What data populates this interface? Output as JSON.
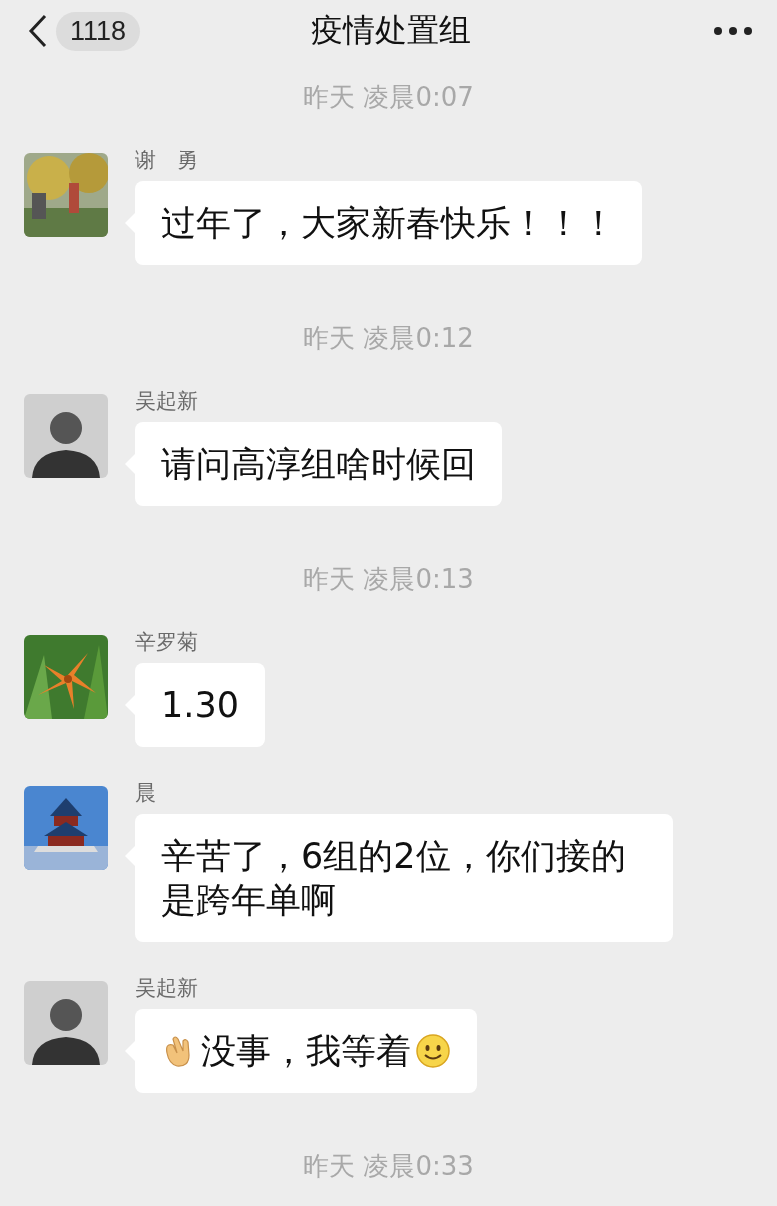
{
  "header": {
    "back_count": "1118",
    "title": "疫情处置组"
  },
  "feed": [
    {
      "kind": "time",
      "text": "昨天 凌晨0:07"
    },
    {
      "kind": "message",
      "sender": "谢　勇",
      "text": "过年了，大家新春快乐！！！"
    },
    {
      "kind": "time",
      "text": "昨天 凌晨0:12"
    },
    {
      "kind": "message",
      "sender": "吴起新",
      "avatar": {
        "kind": "person"
      },
      "text": "请问高淳组啥时候回"
    },
    {
      "kind": "time",
      "text": "昨天 凌晨0:13"
    },
    {
      "kind": "message",
      "sender": "辛罗菊",
      "text": "1.30"
    },
    {
      "kind": "message",
      "sender": "晨",
      "text": "辛苦了，6组的2位，你们接的是跨年单啊"
    },
    {
      "kind": "message",
      "sender": "吴起新",
      "avatar": {
        "kind": "person"
      },
      "text": "没事，我等着",
      "lead_icon": true,
      "trail_icon": true
    },
    {
      "kind": "time",
      "text": "昨天 凌晨0:33"
    }
  ]
}
